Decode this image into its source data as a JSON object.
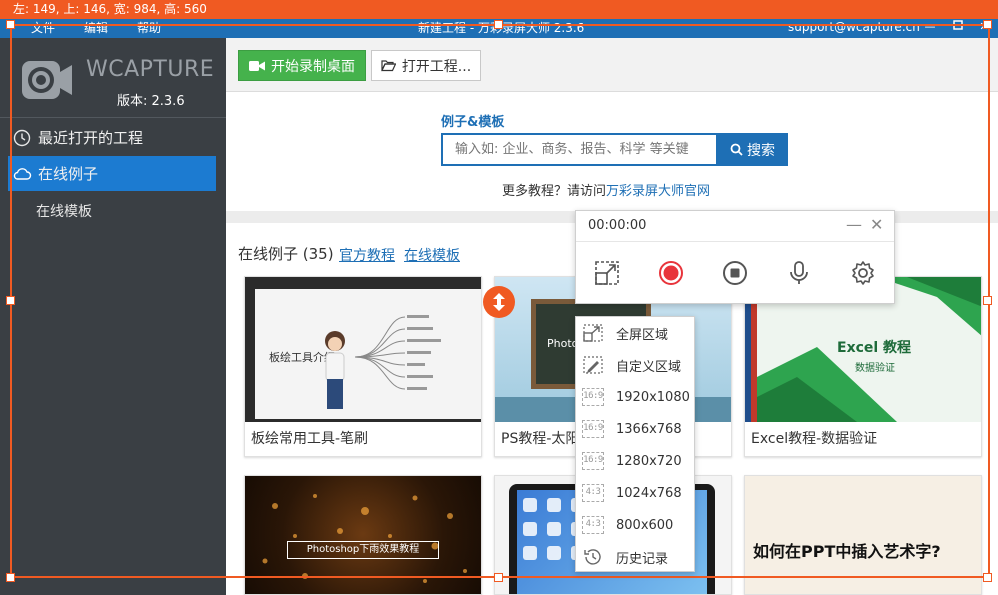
{
  "selection_info": "左: 149, 上: 146, 宽: 984, 高: 560",
  "titlebar": {
    "menu": [
      "文件",
      "编辑",
      "帮助"
    ],
    "title": "新建工程 - 万彩录屏大师 2.3.6",
    "support": "support@wcapture.cn"
  },
  "sidebar": {
    "brand": "WCAPTURE",
    "version": "版本: 2.3.6",
    "items": [
      {
        "label": "最近打开的工程"
      },
      {
        "label": "在线例子"
      }
    ],
    "sub_items": [
      "在线模板"
    ]
  },
  "toolbar": {
    "record_label": "开始录制桌面",
    "open_label": "打开工程..."
  },
  "search": {
    "label": "例子&模板",
    "placeholder": "输入如: 企业、商务、报告、科学 等关键",
    "button": "搜索",
    "tutorial_prefix": "更多教程？请访问",
    "tutorial_link": "万彩录屏大师官网"
  },
  "gallery": {
    "title": "在线例子 (35)",
    "links": [
      "官方教程",
      "在线模板"
    ],
    "cards": [
      {
        "caption": "板绘常用工具-笔刷",
        "thumb_text": "板绘工具介绍"
      },
      {
        "caption": "PS教程-太阳",
        "thumb_text": "Photo"
      },
      {
        "caption": "Excel教程-数据验证",
        "thumb_text": "Excel 教程",
        "thumb_sub": "数据验证"
      },
      {
        "caption": "",
        "thumb_text": "Photoshop下雨效果教程"
      },
      {
        "caption": "",
        "thumb_text": ""
      },
      {
        "caption": "",
        "thumb_text": "如何在PPT中插入艺术字?"
      }
    ]
  },
  "recorder": {
    "time": "00:00:00"
  },
  "dropdown": {
    "items": [
      {
        "label": "全屏区域",
        "icon": "fullscreen-icon"
      },
      {
        "label": "自定义区域",
        "icon": "custom-area-icon"
      },
      {
        "label": "1920x1080",
        "ratio": "16:9"
      },
      {
        "label": "1366x768",
        "ratio": "16:9"
      },
      {
        "label": "1280x720",
        "ratio": "16:9"
      },
      {
        "label": "1024x768",
        "ratio": "4:3"
      },
      {
        "label": "800x600",
        "ratio": "4:3"
      },
      {
        "label": "历史记录",
        "icon": "history-icon"
      }
    ]
  },
  "colors": {
    "accent_blue": "#1e6fb5",
    "sidebar_bg": "#3a3f44",
    "record_green": "#45b24c",
    "selection_orange": "#f05a22",
    "record_red": "#e8343b"
  }
}
